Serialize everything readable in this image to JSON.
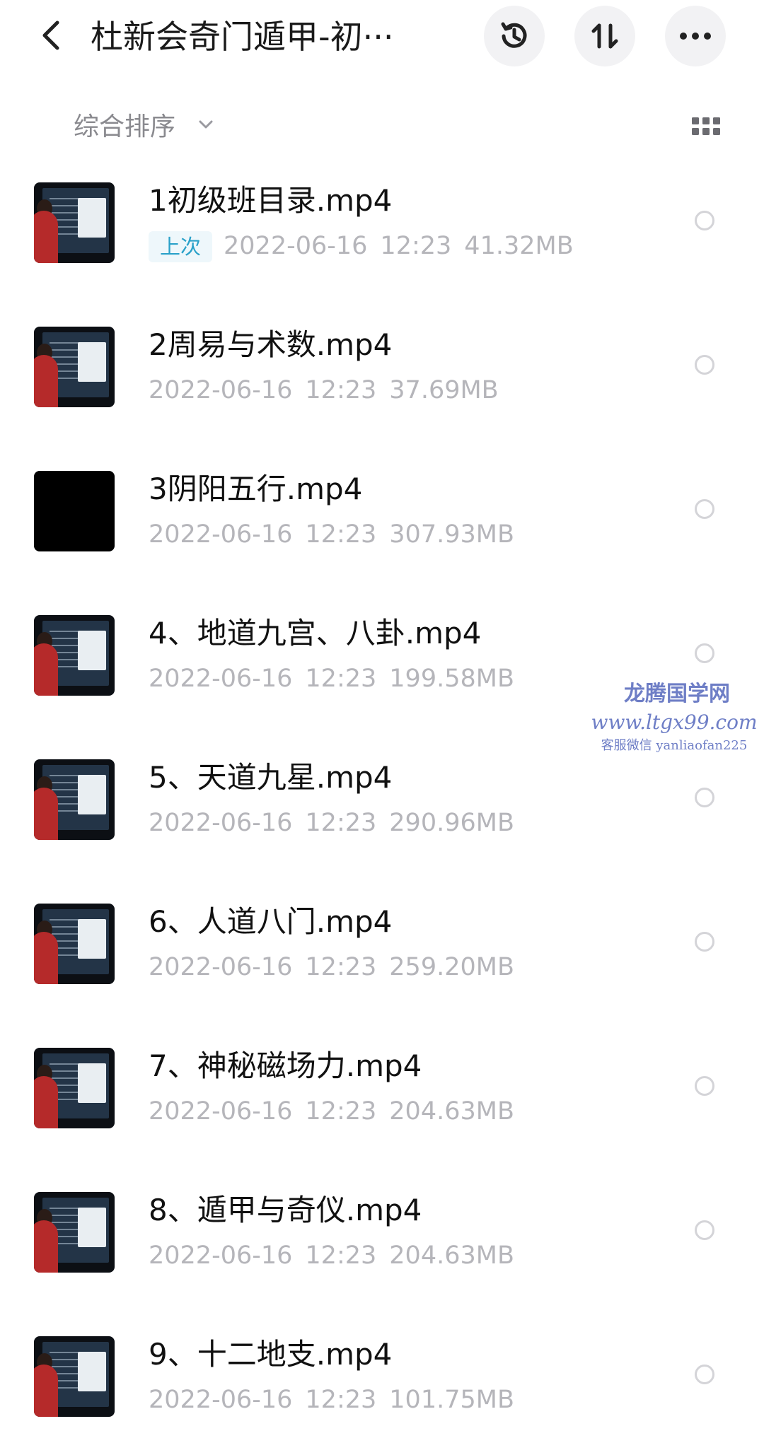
{
  "header": {
    "title": "杜新会奇门遁甲-初···",
    "back_icon": "chevron-left-icon",
    "history_icon": "history-icon",
    "sort_icon": "sort-arrows-icon",
    "more_icon": "more-horizontal-icon"
  },
  "sortbar": {
    "label": "综合排序",
    "chevron_icon": "chevron-down-icon",
    "view_icon": "grid-view-icon"
  },
  "files": [
    {
      "name": "1初级班目录.mp4",
      "badge": "上次",
      "date": "2022-06-16",
      "time": "12:23",
      "size": "41.32MB",
      "thumb": "board"
    },
    {
      "name": "2周易与术数.mp4",
      "badge": "",
      "date": "2022-06-16",
      "time": "12:23",
      "size": "37.69MB",
      "thumb": "board"
    },
    {
      "name": "3阴阳五行.mp4",
      "badge": "",
      "date": "2022-06-16",
      "time": "12:23",
      "size": "307.93MB",
      "thumb": "black"
    },
    {
      "name": "4、地道九宫、八卦.mp4",
      "badge": "",
      "date": "2022-06-16",
      "time": "12:23",
      "size": "199.58MB",
      "thumb": "board"
    },
    {
      "name": "5、天道九星.mp4",
      "badge": "",
      "date": "2022-06-16",
      "time": "12:23",
      "size": "290.96MB",
      "thumb": "board"
    },
    {
      "name": "6、人道八门.mp4",
      "badge": "",
      "date": "2022-06-16",
      "time": "12:23",
      "size": "259.20MB",
      "thumb": "board"
    },
    {
      "name": "7、神秘磁场力.mp4",
      "badge": "",
      "date": "2022-06-16",
      "time": "12:23",
      "size": "204.63MB",
      "thumb": "board"
    },
    {
      "name": "8、遁甲与奇仪.mp4",
      "badge": "",
      "date": "2022-06-16",
      "time": "12:23",
      "size": "204.63MB",
      "thumb": "board"
    },
    {
      "name": "9、十二地支.mp4",
      "badge": "",
      "date": "2022-06-16",
      "time": "12:23",
      "size": "101.75MB",
      "thumb": "board"
    }
  ],
  "watermark": {
    "line1": "龙腾国学网",
    "line2": "www.ltgx99.com",
    "line3": "客服微信 yanliaofan225"
  },
  "colors": {
    "badge_text": "#2aa1c9",
    "meta_text": "#b5b5ba",
    "button_bg": "#f2f2f4",
    "watermark": "#4a5fb8"
  }
}
